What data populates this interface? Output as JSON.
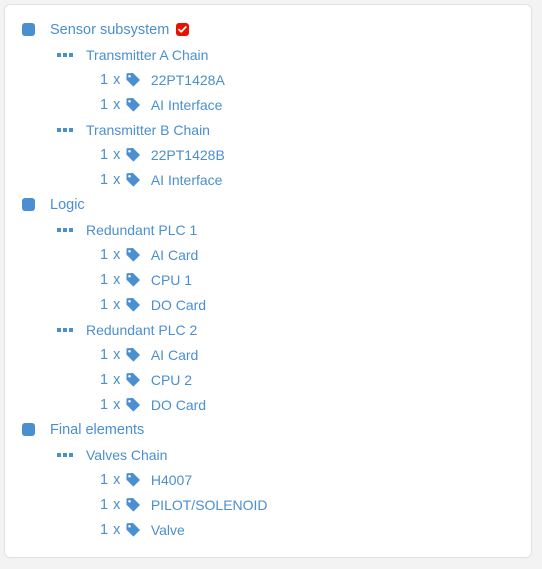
{
  "card": {
    "accent_blue": "#4a8fd0",
    "icon_blue": "#4a90d0",
    "badge_red": "#e51400",
    "background": "#ffffff",
    "border_color": "#e2e2e2"
  },
  "icons": {
    "group": "blue-square-icon",
    "chain": "three-dots-icon",
    "item": "tag-icon",
    "badge": "red-check-icon"
  },
  "tree": [
    {
      "label": "Sensor subsystem",
      "badge": true,
      "children": [
        {
          "label": "Transmitter A Chain",
          "items": [
            {
              "qty": "1 x",
              "name": "22PT1428A"
            },
            {
              "qty": "1 x",
              "name": "AI Interface"
            }
          ]
        },
        {
          "label": "Transmitter B Chain",
          "items": [
            {
              "qty": "1 x",
              "name": "22PT1428B"
            },
            {
              "qty": "1 x",
              "name": "AI Interface"
            }
          ]
        }
      ]
    },
    {
      "label": "Logic",
      "badge": false,
      "children": [
        {
          "label": "Redundant PLC 1",
          "items": [
            {
              "qty": "1 x",
              "name": "AI Card"
            },
            {
              "qty": "1 x",
              "name": "CPU 1"
            },
            {
              "qty": "1 x",
              "name": "DO Card"
            }
          ]
        },
        {
          "label": "Redundant PLC 2",
          "items": [
            {
              "qty": "1 x",
              "name": "AI Card"
            },
            {
              "qty": "1 x",
              "name": "CPU 2"
            },
            {
              "qty": "1 x",
              "name": "DO Card"
            }
          ]
        }
      ]
    },
    {
      "label": "Final elements",
      "badge": false,
      "children": [
        {
          "label": "Valves Chain",
          "items": [
            {
              "qty": "1 x",
              "name": "H4007"
            },
            {
              "qty": "1 x",
              "name": "PILOT/SOLENOID"
            },
            {
              "qty": "1 x",
              "name": "Valve"
            }
          ]
        }
      ]
    }
  ]
}
